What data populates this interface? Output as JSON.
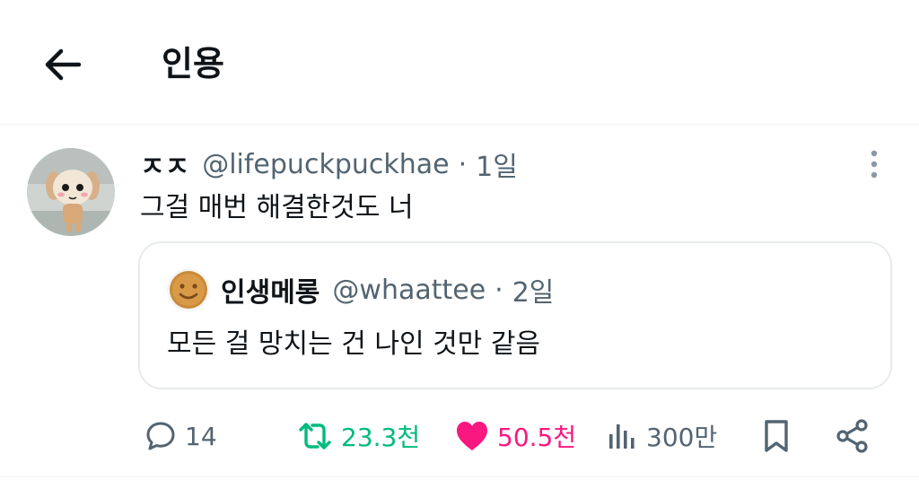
{
  "header": {
    "back_icon": "arrow-left-icon",
    "title": "인용"
  },
  "tweet": {
    "display_name": "ㅈㅈ",
    "handle": "@lifepuckpuckhae",
    "separator": "·",
    "time": "1일",
    "text": "그걸 매번 해결한것도 너",
    "more_icon": "more-vertical-icon",
    "quote": {
      "display_name": "인생메롱",
      "handle": "@whaattee",
      "separator": "·",
      "time": "2일",
      "text": "모든 걸 망치는 건 나인 것만 같음"
    },
    "actions": {
      "reply": {
        "icon": "reply-bubble-icon",
        "count": "14"
      },
      "retweet": {
        "icon": "retweet-icon",
        "count": "23.3천",
        "color": "#00ba7c"
      },
      "like": {
        "icon": "heart-icon",
        "count": "50.5천",
        "color": "#f91880"
      },
      "views": {
        "icon": "views-chart-icon",
        "count": "300만"
      },
      "bookmark": {
        "icon": "bookmark-icon"
      },
      "share": {
        "icon": "share-icon"
      }
    }
  },
  "colors": {
    "text_primary": "#0f1419",
    "text_secondary": "#536471",
    "divider": "#eff3f4",
    "border": "#e7ebed"
  }
}
